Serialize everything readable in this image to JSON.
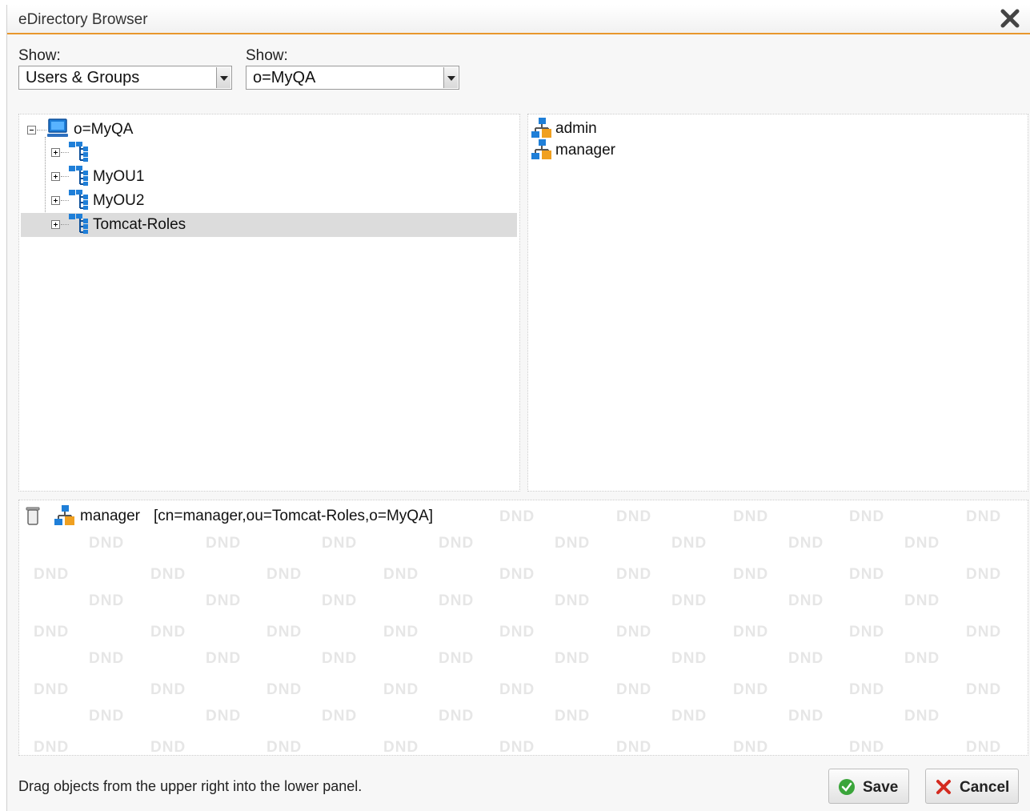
{
  "window": {
    "title": "eDirectory Browser"
  },
  "filters": {
    "show_label_1": "Show:",
    "show_value_1": "Users & Groups",
    "show_label_2": "Show:",
    "show_value_2": "o=MyQA"
  },
  "tree": {
    "root": {
      "label": "o=MyQA",
      "icon": "computer-icon",
      "expanded": true
    },
    "children": [
      {
        "label": "",
        "icon": "org-unit-icon",
        "expanded": false
      },
      {
        "label": "MyOU1",
        "icon": "org-unit-icon",
        "expanded": false
      },
      {
        "label": "MyOU2",
        "icon": "org-unit-icon",
        "expanded": false
      },
      {
        "label": "Tomcat-Roles",
        "icon": "org-unit-icon",
        "expanded": false,
        "selected": true
      }
    ]
  },
  "objects": {
    "items": [
      {
        "label": "admin",
        "icon": "group-icon"
      },
      {
        "label": "manager",
        "icon": "group-icon"
      }
    ]
  },
  "drop_panel": {
    "watermark": "DND",
    "selected_items": [
      {
        "name": "manager",
        "dn": "[cn=manager,ou=Tomcat-Roles,o=MyQA]",
        "icon": "group-icon"
      }
    ]
  },
  "footer": {
    "hint": "Drag objects from the upper right into the lower panel.",
    "save_label": "Save",
    "cancel_label": "Cancel"
  },
  "colors": {
    "accent": "#e8972d",
    "selection": "#dcdcdc",
    "ok_green": "#3aa53a",
    "cancel_red": "#d42a1f"
  }
}
